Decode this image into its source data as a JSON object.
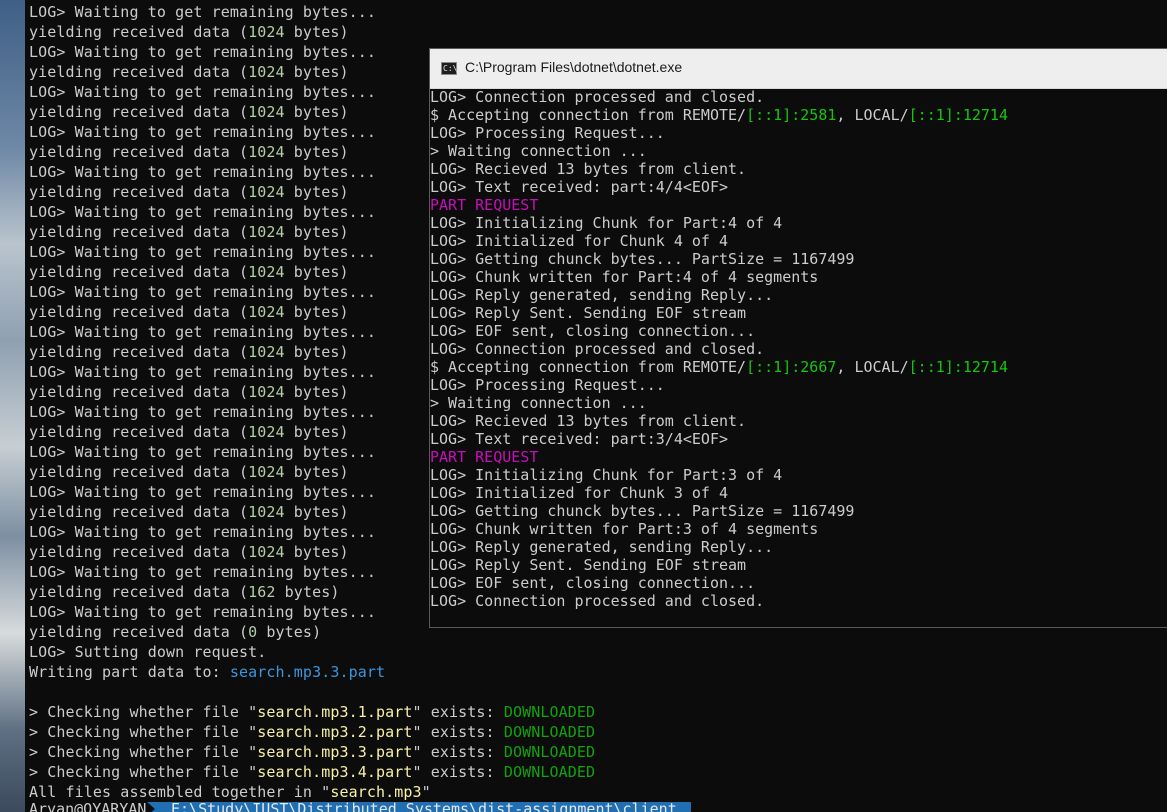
{
  "main_terminal": {
    "lines": [
      [
        {
          "t": "LOG> Waiting to get remaining bytes..."
        }
      ],
      [
        {
          "t": "yielding received data ("
        },
        {
          "t": "1024",
          "c": "num"
        },
        {
          "t": " bytes)"
        }
      ],
      [
        {
          "t": "LOG> Waiting to get remaining bytes..."
        }
      ],
      [
        {
          "t": "yielding received data ("
        },
        {
          "t": "1024",
          "c": "num"
        },
        {
          "t": " bytes)"
        }
      ],
      [
        {
          "t": "LOG> Waiting to get remaining bytes..."
        }
      ],
      [
        {
          "t": "yielding received data ("
        },
        {
          "t": "1024",
          "c": "num"
        },
        {
          "t": " bytes)"
        }
      ],
      [
        {
          "t": "LOG> Waiting to get remaining bytes..."
        }
      ],
      [
        {
          "t": "yielding received data ("
        },
        {
          "t": "1024",
          "c": "num"
        },
        {
          "t": " bytes)"
        }
      ],
      [
        {
          "t": "LOG> Waiting to get remaining bytes..."
        }
      ],
      [
        {
          "t": "yielding received data ("
        },
        {
          "t": "1024",
          "c": "num"
        },
        {
          "t": " bytes)"
        }
      ],
      [
        {
          "t": "LOG> Waiting to get remaining bytes..."
        }
      ],
      [
        {
          "t": "yielding received data ("
        },
        {
          "t": "1024",
          "c": "num"
        },
        {
          "t": " bytes)"
        }
      ],
      [
        {
          "t": "LOG> Waiting to get remaining bytes..."
        }
      ],
      [
        {
          "t": "yielding received data ("
        },
        {
          "t": "1024",
          "c": "num"
        },
        {
          "t": " bytes)"
        }
      ],
      [
        {
          "t": "LOG> Waiting to get remaining bytes..."
        }
      ],
      [
        {
          "t": "yielding received data ("
        },
        {
          "t": "1024",
          "c": "num"
        },
        {
          "t": " bytes)"
        }
      ],
      [
        {
          "t": "LOG> Waiting to get remaining bytes..."
        }
      ],
      [
        {
          "t": "yielding received data ("
        },
        {
          "t": "1024",
          "c": "num"
        },
        {
          "t": " bytes)"
        }
      ],
      [
        {
          "t": "LOG> Waiting to get remaining bytes..."
        }
      ],
      [
        {
          "t": "yielding received data ("
        },
        {
          "t": "1024",
          "c": "num"
        },
        {
          "t": " bytes)"
        }
      ],
      [
        {
          "t": "LOG> Waiting to get remaining bytes..."
        }
      ],
      [
        {
          "t": "yielding received data ("
        },
        {
          "t": "1024",
          "c": "num"
        },
        {
          "t": " bytes)"
        }
      ],
      [
        {
          "t": "LOG> Waiting to get remaining bytes..."
        }
      ],
      [
        {
          "t": "yielding received data ("
        },
        {
          "t": "1024",
          "c": "num"
        },
        {
          "t": " bytes)"
        }
      ],
      [
        {
          "t": "LOG> Waiting to get remaining bytes..."
        }
      ],
      [
        {
          "t": "yielding received data ("
        },
        {
          "t": "1024",
          "c": "num"
        },
        {
          "t": " bytes)"
        }
      ],
      [
        {
          "t": "LOG> Waiting to get remaining bytes..."
        }
      ],
      [
        {
          "t": "yielding received data ("
        },
        {
          "t": "1024",
          "c": "num"
        },
        {
          "t": " bytes)"
        }
      ],
      [
        {
          "t": "LOG> Waiting to get remaining bytes..."
        }
      ],
      [
        {
          "t": "yielding received data ("
        },
        {
          "t": "162",
          "c": "num"
        },
        {
          "t": " bytes)"
        }
      ],
      [
        {
          "t": "LOG> Waiting to get remaining bytes..."
        }
      ],
      [
        {
          "t": "yielding received data ("
        },
        {
          "t": "0",
          "c": "num"
        },
        {
          "t": " bytes)"
        }
      ],
      [
        {
          "t": "LOG> Sutting down request."
        }
      ],
      [
        {
          "t": "Writing part data to: "
        },
        {
          "t": "search.mp3.3.part",
          "c": "file"
        }
      ],
      [
        {
          "t": ""
        }
      ],
      [
        {
          "t": "> Checking whether file \""
        },
        {
          "t": "search.mp3.1.part",
          "c": "str"
        },
        {
          "t": "\" exists: "
        },
        {
          "t": "DOWNLOADED",
          "c": "ok"
        }
      ],
      [
        {
          "t": "> Checking whether file \""
        },
        {
          "t": "search.mp3.2.part",
          "c": "str"
        },
        {
          "t": "\" exists: "
        },
        {
          "t": "DOWNLOADED",
          "c": "ok"
        }
      ],
      [
        {
          "t": "> Checking whether file \""
        },
        {
          "t": "search.mp3.3.part",
          "c": "str"
        },
        {
          "t": "\" exists: "
        },
        {
          "t": "DOWNLOADED",
          "c": "ok"
        }
      ],
      [
        {
          "t": "> Checking whether file \""
        },
        {
          "t": "search.mp3.4.part",
          "c": "str"
        },
        {
          "t": "\" exists: "
        },
        {
          "t": "DOWNLOADED",
          "c": "ok"
        }
      ],
      [
        {
          "t": "All files assembled together in \""
        },
        {
          "t": "search.mp3",
          "c": "str"
        },
        {
          "t": "\""
        }
      ]
    ],
    "prompt": {
      "user": "Aryan@QYARYAN",
      "path": "E:\\Study\\IUST\\Distributed Systems\\dist-assignment\\client"
    }
  },
  "server_window": {
    "title": "C:\\Program Files\\dotnet\\dotnet.exe",
    "icon": "C:\\",
    "lines": [
      [
        {
          "t": "LOG> Connection processed and closed."
        }
      ],
      [
        {
          "t": "$ Accepting connection from REMOTE/"
        },
        {
          "t": "[::1]:2581",
          "c": "green"
        },
        {
          "t": ", LOCAL/"
        },
        {
          "t": "[::1]:12714",
          "c": "green"
        }
      ],
      [
        {
          "t": "LOG> Processing Request..."
        }
      ],
      [
        {
          "t": "> Waiting connection ..."
        }
      ],
      [
        {
          "t": "LOG> Recieved 13 bytes from client."
        }
      ],
      [
        {
          "t": "LOG> Text received: part:4/4<EOF>"
        }
      ],
      [
        {
          "t": "PART REQUEST",
          "c": "mag"
        }
      ],
      [
        {
          "t": "LOG> Initializing Chunk for Part:4 of 4"
        }
      ],
      [
        {
          "t": "LOG> Initialized for Chunk 4 of 4"
        }
      ],
      [
        {
          "t": "LOG> Getting chunck bytes... PartSize = 1167499"
        }
      ],
      [
        {
          "t": "LOG> Chunk written for Part:4 of 4 segments"
        }
      ],
      [
        {
          "t": "LOG> Reply generated, sending Reply..."
        }
      ],
      [
        {
          "t": "LOG> Reply Sent. Sending EOF stream"
        }
      ],
      [
        {
          "t": "LOG> EOF sent, closing connection..."
        }
      ],
      [
        {
          "t": "LOG> Connection processed and closed."
        }
      ],
      [
        {
          "t": "$ Accepting connection from REMOTE/"
        },
        {
          "t": "[::1]:2667",
          "c": "green"
        },
        {
          "t": ", LOCAL/"
        },
        {
          "t": "[::1]:12714",
          "c": "green"
        }
      ],
      [
        {
          "t": "LOG> Processing Request..."
        }
      ],
      [
        {
          "t": "> Waiting connection ..."
        }
      ],
      [
        {
          "t": "LOG> Recieved 13 bytes from client."
        }
      ],
      [
        {
          "t": "LOG> Text received: part:3/4<EOF>"
        }
      ],
      [
        {
          "t": "PART REQUEST",
          "c": "mag"
        }
      ],
      [
        {
          "t": "LOG> Initializing Chunk for Part:3 of 4"
        }
      ],
      [
        {
          "t": "LOG> Initialized for Chunk 3 of 4"
        }
      ],
      [
        {
          "t": "LOG> Getting chunck bytes... PartSize = 1167499"
        }
      ],
      [
        {
          "t": "LOG> Chunk written for Part:3 of 4 segments"
        }
      ],
      [
        {
          "t": "LOG> Reply generated, sending Reply..."
        }
      ],
      [
        {
          "t": "LOG> Reply Sent. Sending EOF stream"
        }
      ],
      [
        {
          "t": "LOG> EOF sent, closing connection..."
        }
      ],
      [
        {
          "t": "LOG> Connection processed and closed."
        }
      ]
    ]
  },
  "colors": {
    "terminal_bg": "#0c0c0c",
    "text": "#cccccc",
    "number": "#b5cea8",
    "filename": "#3a96dd",
    "string": "#f9f1a5",
    "success": "#13a10e",
    "address": "#16c60c",
    "part_request": "#c50fb8",
    "prompt_segment": "#1f6fb2"
  }
}
